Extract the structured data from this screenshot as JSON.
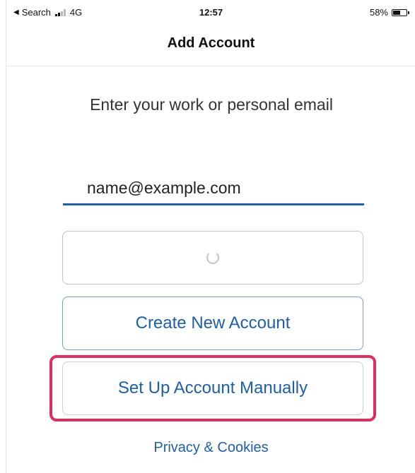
{
  "status_bar": {
    "back_label": "Search",
    "network": "4G",
    "time": "12:57",
    "battery": "58%",
    "battery_level": 0.58,
    "icons": [
      "back-arrow-icon",
      "signal-icon",
      "battery-icon"
    ]
  },
  "nav": {
    "title": "Add Account"
  },
  "form": {
    "prompt": "Enter your work or personal email",
    "email_value": "name@example.com"
  },
  "buttons": {
    "continue_icon": "spinner-icon",
    "create_label": "Create New Account",
    "manual_label": "Set Up Account Manually"
  },
  "highlight_color": "#de2e5f",
  "accent_color": "#1f5fa8",
  "footer": {
    "privacy_label": "Privacy & Cookies"
  }
}
